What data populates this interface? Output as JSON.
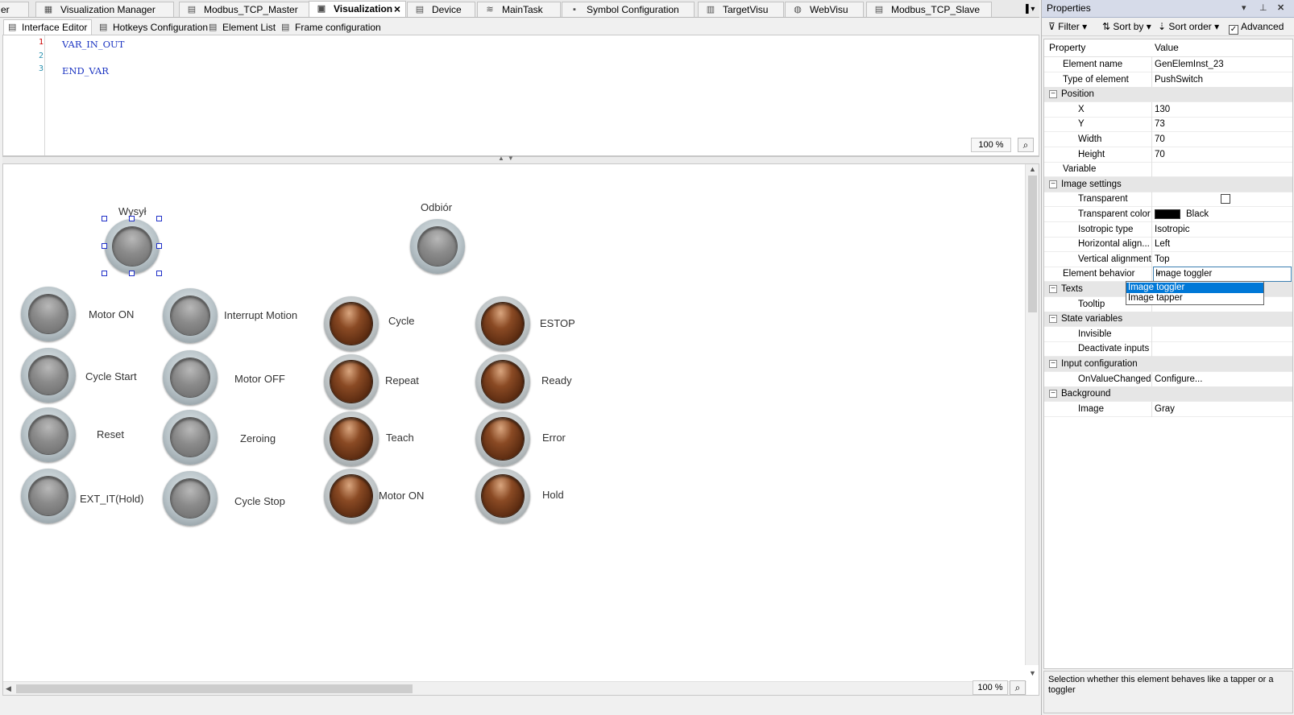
{
  "doc_tabs": [
    {
      "label": "er",
      "icon": "",
      "active": false
    },
    {
      "label": "Visualization Manager",
      "icon": "visu-manager-icon",
      "active": false
    },
    {
      "label": "Modbus_TCP_Master",
      "icon": "device-icon",
      "active": false
    },
    {
      "label": "Visualization",
      "icon": "visualization-icon",
      "active": true
    },
    {
      "label": "Device",
      "icon": "device-icon",
      "active": false
    },
    {
      "label": "MainTask",
      "icon": "task-icon",
      "active": false
    },
    {
      "label": "Symbol Configuration",
      "icon": "symbol-config-icon",
      "active": false
    },
    {
      "label": "TargetVisu",
      "icon": "target-visu-icon",
      "active": false
    },
    {
      "label": "WebVisu",
      "icon": "web-visu-icon",
      "active": false
    },
    {
      "label": "Modbus_TCP_Slave",
      "icon": "device-icon",
      "active": false
    }
  ],
  "editor_tabs": [
    {
      "label": "Interface Editor",
      "active": true
    },
    {
      "label": "Hotkeys Configuration",
      "active": false
    },
    {
      "label": "Element List",
      "active": false
    },
    {
      "label": "Frame configuration",
      "active": false
    }
  ],
  "declaration": {
    "lines": [
      {
        "no": "1",
        "text": "VAR_IN_OUT"
      },
      {
        "no": "2",
        "text": ""
      },
      {
        "no": "3",
        "text": "END_VAR"
      }
    ],
    "zoom": "100 %"
  },
  "canvas": {
    "zoom": "100 %",
    "push_buttons": [
      {
        "label": "Wysył",
        "selected": true
      },
      {
        "label": "Odbiór",
        "selected": false
      },
      {
        "label": "Motor ON",
        "selected": false
      },
      {
        "label": "Interrupt Motion",
        "selected": false
      },
      {
        "label": "Cycle Start",
        "selected": false
      },
      {
        "label": "Motor OFF",
        "selected": false
      },
      {
        "label": "Reset",
        "selected": false
      },
      {
        "label": "Zeroing",
        "selected": false
      },
      {
        "label": "EXT_IT(Hold)",
        "selected": false
      },
      {
        "label": "Cycle Stop",
        "selected": false
      }
    ],
    "lamps": [
      {
        "label": "Cycle"
      },
      {
        "label": "ESTOP"
      },
      {
        "label": "Repeat"
      },
      {
        "label": "Ready"
      },
      {
        "label": "Teach"
      },
      {
        "label": "Error"
      },
      {
        "label": "Motor ON"
      },
      {
        "label": "Hold"
      }
    ]
  },
  "properties": {
    "title": "Properties",
    "toolbar": {
      "filter": "Filter",
      "sort_by": "Sort by",
      "sort_order": "Sort order",
      "advanced": "Advanced",
      "advanced_checked": true
    },
    "columns": {
      "property": "Property",
      "value": "Value"
    },
    "rows": [
      {
        "name": "Element name",
        "value": "GenElemInst_23",
        "level": 1,
        "group": false
      },
      {
        "name": "Type of element",
        "value": "PushSwitch",
        "level": 1,
        "group": false
      },
      {
        "name": "Position",
        "value": "",
        "level": 0,
        "group": true
      },
      {
        "name": "X",
        "value": "130",
        "level": 2,
        "group": false
      },
      {
        "name": "Y",
        "value": "73",
        "level": 2,
        "group": false
      },
      {
        "name": "Width",
        "value": "70",
        "level": 2,
        "group": false
      },
      {
        "name": "Height",
        "value": "70",
        "level": 2,
        "group": false
      },
      {
        "name": "Variable",
        "value": "",
        "level": 1,
        "group": false
      },
      {
        "name": "Image settings",
        "value": "",
        "level": 0,
        "group": true
      },
      {
        "name": "Transparent",
        "value": "",
        "level": 2,
        "group": false,
        "type": "checkbox"
      },
      {
        "name": "Transparent color",
        "value": "Black",
        "level": 2,
        "group": false,
        "type": "color",
        "color": "#000000"
      },
      {
        "name": "Isotropic type",
        "value": "Isotropic",
        "level": 2,
        "group": false
      },
      {
        "name": "Horizontal align...",
        "value": "Left",
        "level": 2,
        "group": false
      },
      {
        "name": "Vertical alignment",
        "value": "Top",
        "level": 2,
        "group": false
      },
      {
        "name": "Element behavior",
        "value": "Image toggler",
        "level": 1,
        "group": false,
        "type": "select"
      },
      {
        "name": "Texts",
        "value": "",
        "level": 0,
        "group": true
      },
      {
        "name": "Tooltip",
        "value": "",
        "level": 2,
        "group": false
      },
      {
        "name": "State variables",
        "value": "",
        "level": 0,
        "group": true
      },
      {
        "name": "Invisible",
        "value": "",
        "level": 2,
        "group": false
      },
      {
        "name": "Deactivate inputs",
        "value": "",
        "level": 2,
        "group": false
      },
      {
        "name": "Input configuration",
        "value": "",
        "level": 0,
        "group": true
      },
      {
        "name": "OnValueChanged",
        "value": "Configure...",
        "level": 2,
        "group": false
      },
      {
        "name": "Background",
        "value": "",
        "level": 0,
        "group": true
      },
      {
        "name": "Image",
        "value": "Gray",
        "level": 2,
        "group": false
      }
    ],
    "behavior_options": [
      {
        "label": "Image toggler",
        "selected": true
      },
      {
        "label": "Image tapper",
        "selected": false
      }
    ],
    "description": "Selection whether this element behaves like a tapper or a toggler"
  },
  "colors": {
    "selection_handle": "#2030c8",
    "list_highlight": "#0078d7",
    "code_keyword": "#1b34c2"
  }
}
